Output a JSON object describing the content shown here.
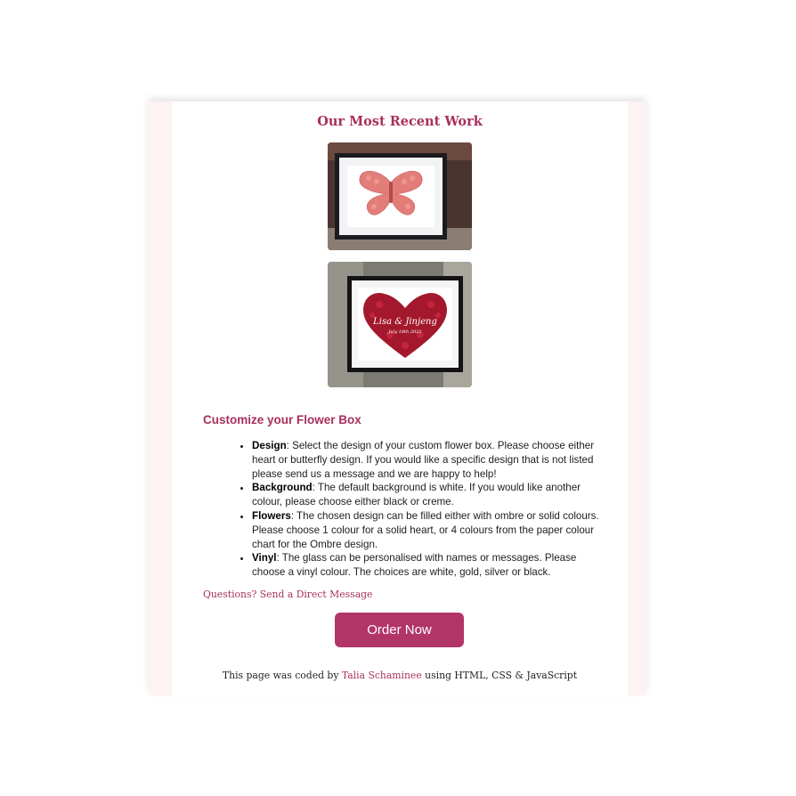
{
  "recent_work": {
    "title": "Our Most Recent Work",
    "photos": [
      {
        "subject": "butterfly-flower-box"
      },
      {
        "subject": "heart-flower-box",
        "inscription": "Lisa & Jinjeng",
        "date_text": "July 18th 2022"
      }
    ]
  },
  "customize": {
    "title": "Customize your Flower Box",
    "options": [
      {
        "label": "Design",
        "text": ": Select the design of your custom flower box. Please choose either heart or butterfly design. If you would like a specific design that is not listed please send us a message and we are happy to help!"
      },
      {
        "label": "Background",
        "text": ": The default background is white. If you would like another colour, please choose either black or creme."
      },
      {
        "label": "Flowers",
        "text": ": The chosen design can be filled either with ombre or solid colours. Please choose 1 colour for a solid heart, or 4 colours from the paper colour chart for the Ombre design."
      },
      {
        "label": "Vinyl",
        "text": ": The glass can be personalised with names or messages. Please choose a vinyl colour. The choices are white, gold, silver or black."
      }
    ],
    "questions_link": "Questions? Send a Direct Message",
    "order_button": "Order Now"
  },
  "footer": {
    "prefix": "This page was coded by ",
    "author": "Talia Schaminee",
    "suffix": " using HTML, CSS & JavaScript"
  },
  "colors": {
    "accent": "#a8305d",
    "button": "#b23567",
    "side_panel": "#fdf3f3"
  }
}
